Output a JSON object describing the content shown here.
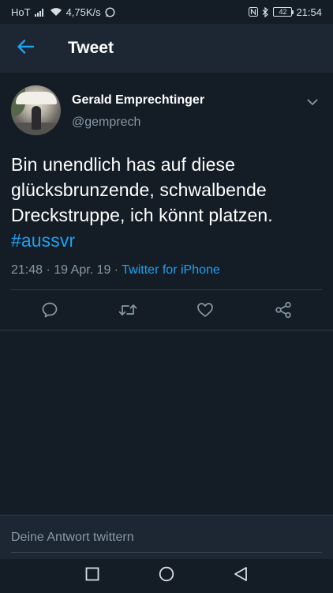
{
  "status_bar": {
    "carrier": "HoT",
    "speed": "4,75K/s",
    "battery": "42",
    "time": "21:54"
  },
  "header": {
    "title": "Tweet"
  },
  "tweet": {
    "display_name": "Gerald Emprechtinger",
    "handle": "@gemprech",
    "text_lines": [
      "Bin unendlich has auf diese",
      "glücksbrunzende, schwalbende",
      "Dreckstruppe, ich könnt platzen."
    ],
    "hashtag": "#aussvr",
    "time": "21:48",
    "date": "19 Apr. 19",
    "source": "Twitter for iPhone"
  },
  "reply": {
    "placeholder": "Deine Antwort twittern"
  },
  "colors": {
    "background": "#141d26",
    "header": "#1c2733",
    "accent": "#1da1f2",
    "secondary_text": "#8899a6"
  },
  "icons": {
    "back": "arrow-left-icon",
    "caret": "chevron-down-icon",
    "reply": "comment-icon",
    "retweet": "retweet-icon",
    "like": "heart-icon",
    "share": "share-icon"
  }
}
